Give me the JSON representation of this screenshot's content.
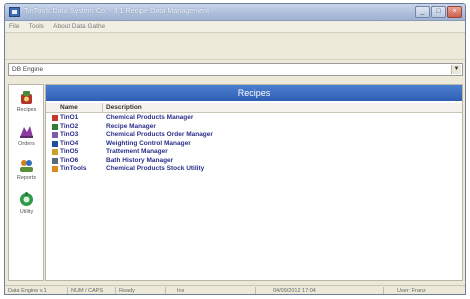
{
  "window": {
    "title": "TinTools Data System Co. - 3.1 Recipe Data Management"
  },
  "menu": {
    "items": [
      "File",
      "Tools",
      "About Data Gathe"
    ]
  },
  "combo": {
    "value": "DB Engine"
  },
  "sidebar": {
    "buttons": [
      {
        "label": "Recipes",
        "icon": "recipes-icon"
      },
      {
        "label": "Orders",
        "icon": "orders-icon"
      },
      {
        "label": "Reports",
        "icon": "reports-icon"
      },
      {
        "label": "Utility",
        "icon": "utility-icon"
      }
    ]
  },
  "panel": {
    "title": "Recipes",
    "columns": [
      "Name",
      "Description"
    ],
    "rows": [
      {
        "name": "TinO1",
        "description": "Chemical Products Manager",
        "icon_color": "#c0392b"
      },
      {
        "name": "TinO2",
        "description": "Recipe Manager",
        "icon_color": "#2e7d32"
      },
      {
        "name": "TinO3",
        "description": "Chemical Products Order Manager",
        "icon_color": "#7b5ea7"
      },
      {
        "name": "TinO4",
        "description": "Weighting Control Manager",
        "icon_color": "#1f4f9e"
      },
      {
        "name": "TinO5",
        "description": "Trattement Manager",
        "icon_color": "#c8a12a"
      },
      {
        "name": "TinO6",
        "description": "Bath History Manager",
        "icon_color": "#5a6a7a"
      },
      {
        "name": "TinTools",
        "description": "Chemical Products Stock Utility",
        "icon_color": "#e08a1e"
      }
    ]
  },
  "statusbar": {
    "cells": [
      "Data Engine v.1",
      "NUM / CAPS",
      "Ready",
      "Ins",
      "04/09/2012 17:04",
      "User: Franz"
    ]
  },
  "colors": {
    "header_blue": "#3a6cc2",
    "row_text": "#2c2f8a"
  }
}
